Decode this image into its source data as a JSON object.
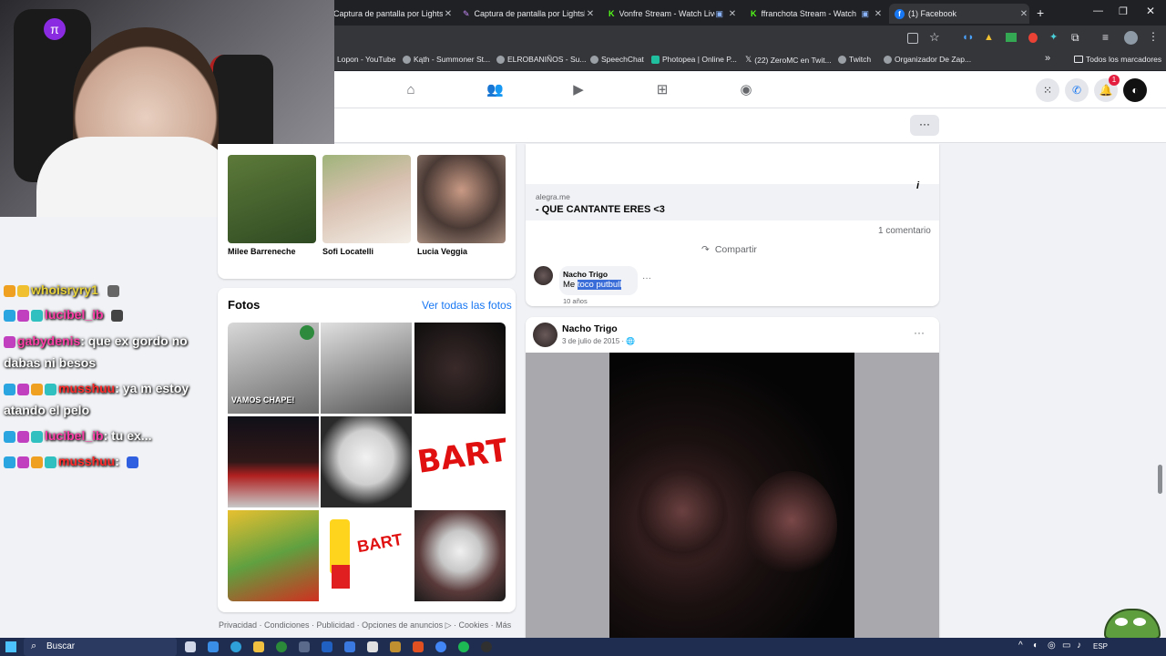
{
  "tabs": [
    {
      "title": "Captura de pantalla por Lightsh",
      "active": false
    },
    {
      "title": "Captura de pantalla por Lightsh",
      "active": false
    },
    {
      "title": "Vonfre Stream - Watch Live",
      "active": false
    },
    {
      "title": "ffranchota Stream - Watch",
      "active": false
    },
    {
      "title": "(1) Facebook",
      "active": true
    }
  ],
  "new_tab_label": "+",
  "bookmarks": [
    "Lopon - YouTube",
    "Kąth - Summoner St...",
    "ELROBANIÑOS - Su...",
    "SpeechChat",
    "Photopea | Online P...",
    "(22) ZeroMC en Twit...",
    "Twitch",
    "Organizador De Zap..."
  ],
  "bookmarks_more": "»",
  "all_bookmarks": "Todos los marcadores",
  "notif_count": "1",
  "friends": [
    {
      "name": "Milee Barreneche"
    },
    {
      "name": "Sofi Locatelli"
    },
    {
      "name": "Lucia Veggia"
    }
  ],
  "photos_section": {
    "title": "Fotos",
    "see_all": "Ver todas las fotos",
    "captions": [
      "VAMOS CHAPE!",
      "BART",
      "BART"
    ]
  },
  "footer_links": "Privacidad · Condiciones · Publicidad · Opciones de anuncios ▷ · Cookies · Más",
  "chat": [
    {
      "user": "whoisryry1",
      "color": "#e8d23a",
      "message": ""
    },
    {
      "user": "lucibel_ib",
      "color": "#ff3fa8",
      "message": ""
    },
    {
      "user": "gabydenis",
      "color": "#ff3fa8",
      "message": ": que ex gordo no"
    },
    {
      "user": "",
      "color": "#ffffff",
      "message": "dabas ni besos"
    },
    {
      "user": "musshuu",
      "color": "#ff2a2a",
      "message": ": ya m estoy"
    },
    {
      "user": "",
      "color": "#ffffff",
      "message": "atando el pelo"
    },
    {
      "user": "lucibel_ib",
      "color": "#ff3fa8",
      "message": ": tu ex..."
    },
    {
      "user": "musshuu",
      "color": "#ff2a2a",
      "message": ":"
    }
  ],
  "post1": {
    "link_domain": "alegra.me",
    "link_title": "- QUE CANTANTE ERES <3",
    "comments_count": "1 comentario",
    "share": "Compartir",
    "info_icon": "i",
    "comment": {
      "author": "Nacho Trigo",
      "text_plain": "Me ",
      "text_selected": "toco putbull",
      "time": "10 años",
      "more": "···"
    }
  },
  "post2": {
    "author": "Nacho Trigo",
    "date": "3 de julio de 2015 ·",
    "more": "···"
  },
  "taskbar": {
    "search": "Buscar",
    "lang": "ESP"
  }
}
